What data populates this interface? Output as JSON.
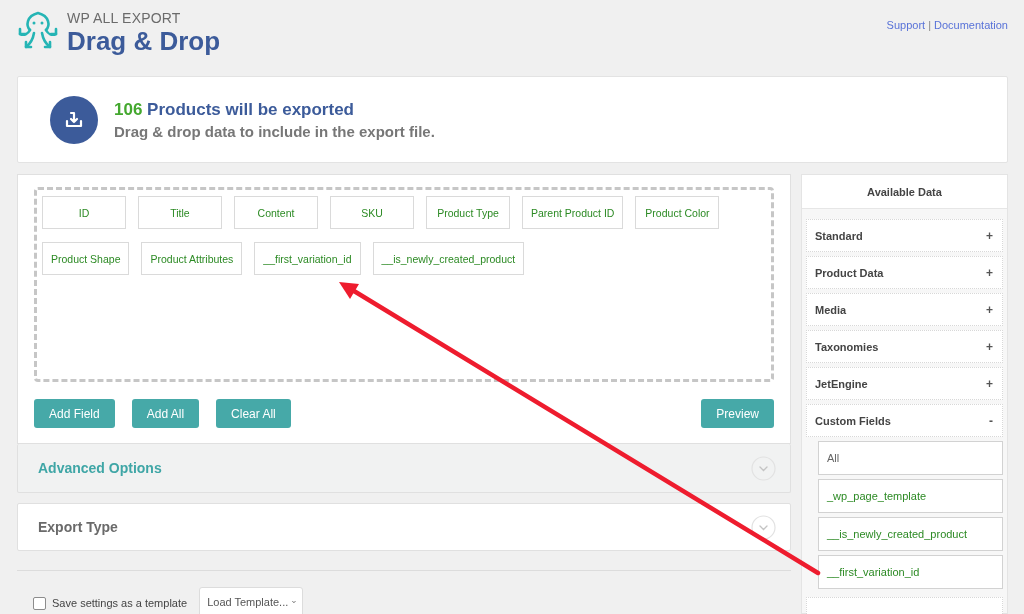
{
  "header": {
    "brand": "WP ALL EXPORT",
    "title": "Drag & Drop",
    "links": [
      "Support",
      "Documentation"
    ],
    "separator": "|"
  },
  "summary": {
    "count": "106",
    "title": "Products will be exported",
    "subtitle": "Drag & drop data to include in the export file."
  },
  "export_fields": [
    "ID",
    "Title",
    "Content",
    "SKU",
    "Product Type",
    "Parent Product ID",
    "Product Color",
    "Product Shape",
    "Product Attributes",
    "__first_variation_id",
    "__is_newly_created_product"
  ],
  "actions": {
    "left": [
      "Add Field",
      "Add All",
      "Clear All"
    ],
    "right": [
      "Preview"
    ]
  },
  "sections": [
    {
      "title": "Advanced Options",
      "highlighted": true
    },
    {
      "title": "Export Type",
      "highlighted": false
    }
  ],
  "footer": {
    "save_template": {
      "label": "Save settings as a template",
      "checked": false
    },
    "template_select": {
      "value": "Load Template..."
    }
  },
  "sidebar": {
    "title": "Available Data",
    "groups": [
      {
        "kind": "group",
        "label": "Standard",
        "toggle": "+"
      },
      {
        "kind": "group",
        "label": "Product Data",
        "toggle": "+"
      },
      {
        "kind": "group",
        "label": "Media",
        "toggle": "+"
      },
      {
        "kind": "group",
        "label": "Taxonomies",
        "toggle": "+"
      },
      {
        "kind": "group",
        "label": "JetEngine",
        "toggle": "+"
      },
      {
        "kind": "group",
        "label": "Custom Fields",
        "toggle": "-",
        "children": [
          {
            "label": "All",
            "kind": "all"
          },
          {
            "label": "_wp_page_template",
            "kind": "field"
          },
          {
            "label": "__is_newly_created_product",
            "kind": "field"
          },
          {
            "label": "__first_variation_id",
            "kind": "field"
          }
        ]
      },
      {
        "kind": "cut_off"
      }
    ]
  }
}
